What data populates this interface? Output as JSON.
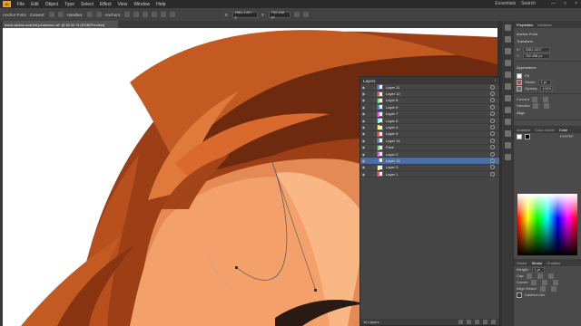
{
  "menubar": {
    "logo": "Ai",
    "items": [
      "File",
      "Edit",
      "Object",
      "Type",
      "Select",
      "Effect",
      "View",
      "Window",
      "Help"
    ],
    "workspace": [
      "Essentials",
      "Search"
    ],
    "window_controls": [
      "—",
      "□",
      "×"
    ]
  },
  "controlbar": {
    "label_anchor": "Anchor Point",
    "label_convert": "Convert:",
    "label_handles": "Handles:",
    "label_anchors": "Anchors:",
    "x_value": "2961.1497 p",
    "y_value": "752.498 px"
  },
  "document": {
    "tab_title": "black-widow-scarlett-johansson.ai* @ 82.81 % (RGB/Preview)"
  },
  "layers_panel": {
    "title": "Layers",
    "layers": [
      {
        "name": "Layer 11",
        "color": "#4f7fff",
        "selected": false
      },
      {
        "name": "Layer 10",
        "color": "#ff4f4f",
        "selected": false
      },
      {
        "name": "Layer 8",
        "color": "#4fff4f",
        "selected": false
      },
      {
        "name": "Layer 9",
        "color": "#4f7fff",
        "selected": false
      },
      {
        "name": "Layer 7",
        "color": "#ff4fff",
        "selected": false
      },
      {
        "name": "Layer 6",
        "color": "#4fffff",
        "selected": false
      },
      {
        "name": "Layer 4",
        "color": "#ffff4f",
        "selected": false
      },
      {
        "name": "Layer 5",
        "color": "#ff4f4f",
        "selected": false
      },
      {
        "name": "Layer 14",
        "color": "#4f7fff",
        "selected": false
      },
      {
        "name": "Face",
        "color": "#4fff4f",
        "selected": false
      },
      {
        "name": "Layer 2",
        "color": "#ff4fff",
        "selected": false
      },
      {
        "name": "Layer 13",
        "color": "#4f7fff",
        "selected": true
      },
      {
        "name": "Layer 3",
        "color": "#ffff4f",
        "selected": false
      },
      {
        "name": "Layer 1",
        "color": "#ff4f4f",
        "selected": false
      }
    ],
    "footer": "16 Layers"
  },
  "rightpanel": {
    "tabs": [
      "Properties",
      "Libraries"
    ],
    "anchor_label": "Anchor Point",
    "transform_title": "Transform",
    "x_label": "X:",
    "x_value": "2961.1497",
    "y_label": "Y:",
    "y_value": "752.498 px",
    "appearance_title": "Appearance",
    "fill_label": "Fill",
    "stroke_label": "Stroke",
    "stroke_value": "1 pt",
    "opacity_label": "Opacity",
    "opacity_value": "100%",
    "convert_label": "Convert",
    "handles_label": "Handles",
    "align_label": "Align",
    "swatch_tabs": [
      "Gradient",
      "Color Guide",
      "Color"
    ],
    "color_hex": "FFFFFF",
    "stroke_tabs": [
      "Stroke",
      "Stroke",
      "Gradient"
    ],
    "weight_label": "Weight:",
    "weight_value": "1 pt",
    "cap_label": "Cap:",
    "corner_label": "Corner:",
    "align_stroke_label": "Align Stroke:",
    "dashed_label": "Dashed Line"
  },
  "colors": {
    "hair_dark": "#7a2e10",
    "hair_mid": "#b8501e",
    "hair_light": "#e07a3c",
    "skin": "#f4a06a",
    "skin_light": "#f9b785",
    "skin_shadow": "#e48a55",
    "selection": "#4a6ea0"
  }
}
